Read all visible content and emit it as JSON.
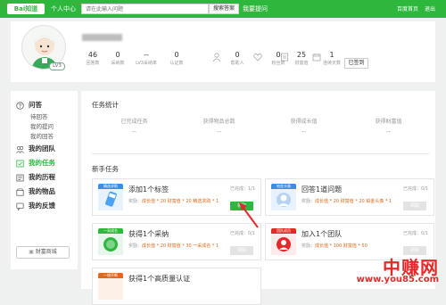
{
  "header": {
    "logo": "Bai知道",
    "personal_center": "个人中心",
    "search_placeholder": "请在此输入问题",
    "search_button": "搜索答案",
    "ask_link": "我要提问",
    "top_right": [
      "百度首页",
      "退出"
    ]
  },
  "profile": {
    "level_badge": "LV3",
    "stats": [
      {
        "num": "46",
        "label": "回答数"
      },
      {
        "num": "0",
        "label": "采纳数"
      },
      {
        "num": "--",
        "label": "LV3采纳率"
      },
      {
        "num": "0",
        "label": "认证数"
      }
    ],
    "stats2": [
      {
        "num": "0",
        "label": "帮助人"
      },
      {
        "num": "0",
        "label": "粉丝数"
      },
      {
        "num": "25",
        "label": "财富值"
      },
      {
        "num": "1",
        "label": "连续天数"
      }
    ],
    "checkin_button": "已签到"
  },
  "sidebar": {
    "qa_title": "问答",
    "qa_items": [
      "待回答",
      "我的提问",
      "我的回答"
    ],
    "items": [
      "我的团队",
      "我的任务",
      "我的历程",
      "我的物品",
      "我的反馈"
    ],
    "mall_button": "财富商城"
  },
  "main": {
    "stats_title": "任务统计",
    "stats": [
      {
        "label": "已完成任务",
        "value": "--"
      },
      {
        "label": "获得物品总数",
        "value": "--"
      },
      {
        "label": "获得成长值",
        "value": "--"
      },
      {
        "label": "获得财富值",
        "value": "--"
      }
    ],
    "newbie_title": "新手任务",
    "tasks": [
      {
        "tag": "精选求助",
        "title": "添加1个标签",
        "progress": "已完成：1/1",
        "reward_prefix": "奖励：",
        "reward": "成长值 * 20  财富值 * 20  精选求助 * 1",
        "button": "领取",
        "claimable": true,
        "tag_color": "#3a8ee6"
      },
      {
        "tag": "铂金头像",
        "title": "回答1道问题",
        "progress": "已完成：0/1",
        "reward_prefix": "奖励：",
        "reward": "成长值 * 20  财富值 * 20  铂金头像 * 1",
        "button": "领取",
        "claimable": false,
        "tag_color": "#3a8ee6"
      },
      {
        "tag": "一采成名",
        "title": "获得1个采纳",
        "progress": "已完成：0/1",
        "reward_prefix": "奖励：",
        "reward": "成长值 * 20  财富值 * 30  一采成名 * 1",
        "button": "领取",
        "claimable": false,
        "tag_color": "#2db83d"
      },
      {
        "tag": "团队成员",
        "title": "加入1个团队",
        "progress": "已完成：0/1",
        "reward_prefix": "奖励：",
        "reward": "成长值 * 100  财富值 * 50",
        "button": "领取",
        "claimable": false,
        "tag_color": "#e4292b"
      },
      {
        "tag": "一炮不断",
        "title": "获得1个高质量认证",
        "progress": "",
        "reward_prefix": "",
        "reward": "",
        "button": "",
        "claimable": false,
        "tag_color": "#e06a1b"
      }
    ]
  },
  "watermark": {
    "big": "中赚网",
    "small": "www.you85.com"
  }
}
